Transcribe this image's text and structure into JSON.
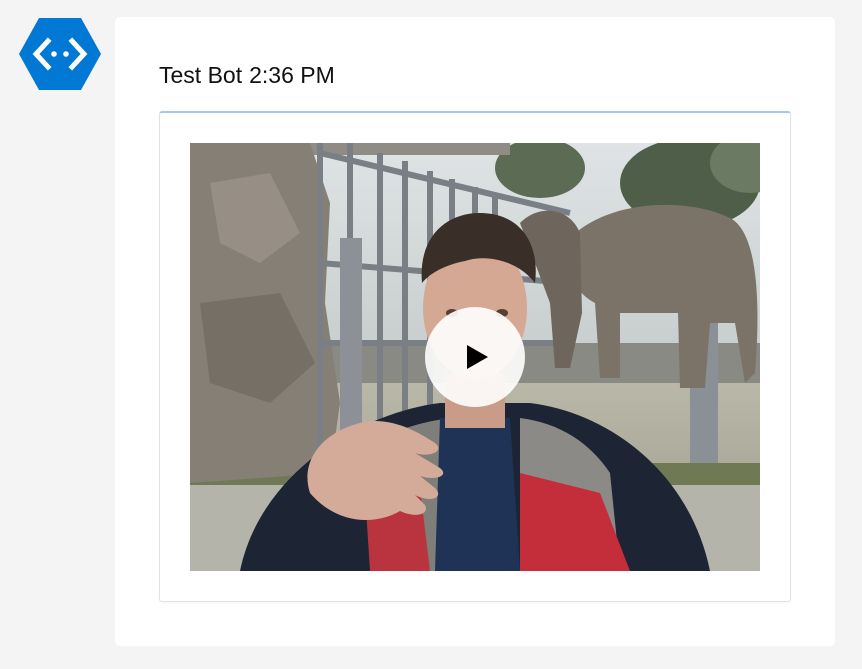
{
  "message": {
    "sender": "Test Bot",
    "timestamp": "2:36 PM",
    "avatar_icon": "bot-hexagon-icon",
    "avatar_color": "#0078d4"
  },
  "attachment": {
    "type": "video",
    "play_icon": "play-icon",
    "accent_color": "#a7c8ea"
  }
}
